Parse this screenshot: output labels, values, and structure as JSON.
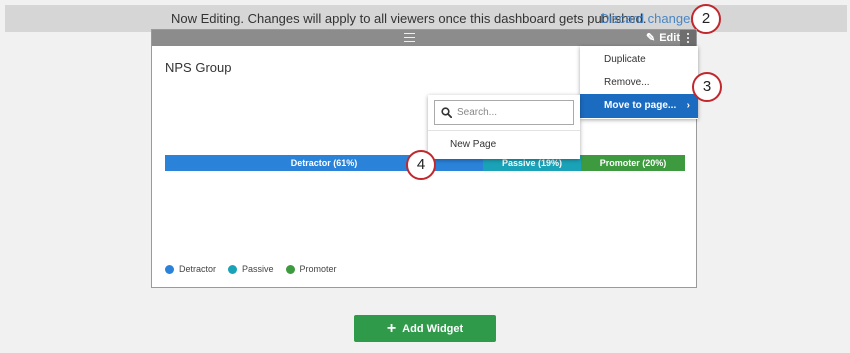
{
  "banner": {
    "message": "Now Editing. Changes will apply to all viewers once this dashboard gets published.",
    "discard_link": "Discard changes?"
  },
  "callouts": [
    "2",
    "3",
    "4"
  ],
  "widget": {
    "edit_label": "Edit",
    "title": "NPS Group",
    "bar_segments": [
      {
        "label": "Detractor (61%)",
        "percent": 61,
        "color": "#2b82d9"
      },
      {
        "label": "Passive (19%)",
        "percent": 19,
        "color": "#1aa3b8"
      },
      {
        "label": "Promoter (20%)",
        "percent": 20,
        "color": "#3e9a3f"
      }
    ],
    "legend": [
      {
        "label": "Detractor",
        "color": "#2b82d9"
      },
      {
        "label": "Passive",
        "color": "#1aa3b8"
      },
      {
        "label": "Promoter",
        "color": "#3e9a3f"
      }
    ]
  },
  "menu": {
    "items": [
      "Duplicate",
      "Remove...",
      "Move to page..."
    ],
    "active_color": "#1b6bc1"
  },
  "submenu": {
    "search_placeholder": "Search...",
    "items": [
      "New Page"
    ]
  },
  "add_widget": {
    "label": "Add Widget",
    "color": "#2e9a4a"
  }
}
